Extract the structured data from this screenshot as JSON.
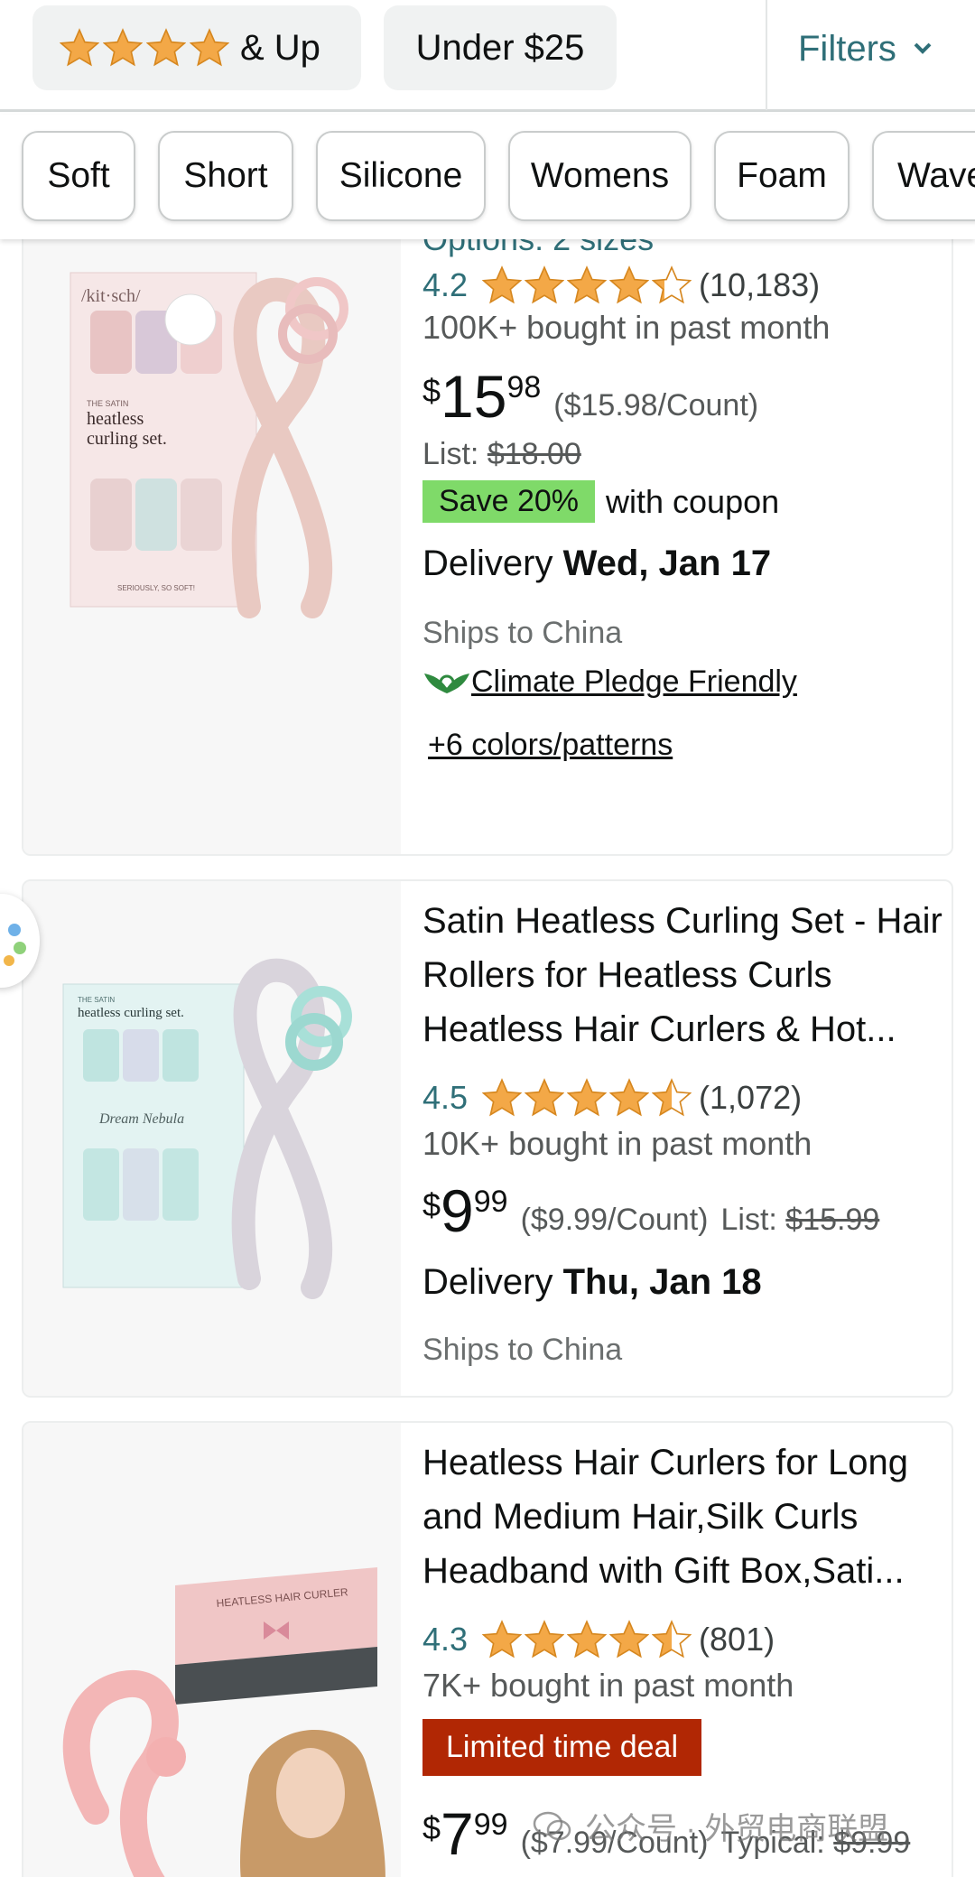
{
  "top_filters": {
    "rating_chip": "& Up",
    "price_chip": "Under $25",
    "filters_label": "Filters"
  },
  "chips": [
    "Soft",
    "Short",
    "Silicone",
    "Womens",
    "Foam",
    "Wave"
  ],
  "products": [
    {
      "options_label": "Options:",
      "options_value": "2 sizes",
      "rating": "4.2",
      "rating_count": "(10,183)",
      "bought": "100K+ bought in past month",
      "price_symbol": "$",
      "price_whole": "15",
      "price_fraction": "98",
      "unit_price": "($15.98/Count)",
      "list_label": "List:",
      "list_price": "$18.00",
      "save_badge": "Save 20%",
      "coupon_text": "with coupon",
      "delivery_label": "Delivery",
      "delivery_date": "Wed, Jan 17",
      "ships": "Ships to China",
      "climate": "Climate Pledge Friendly",
      "colors": "+6 colors/patterns",
      "image_text": {
        "brand": "/kit·sch/",
        "box_line1": "THE SATIN",
        "box_line2": "heatless",
        "box_line3": "curling set.",
        "box_tag": "SERIOUSLY, SO SOFT!"
      }
    },
    {
      "title": "Satin Heatless Curling Set - Hair Rollers for Heatless Curls Heatless Hair Curlers & Hot...",
      "rating": "4.5",
      "rating_count": "(1,072)",
      "bought": "10K+ bought in past month",
      "price_symbol": "$",
      "price_whole": "9",
      "price_fraction": "99",
      "unit_price": "($9.99/Count)",
      "list_label": "List:",
      "list_price": "$15.99",
      "delivery_label": "Delivery",
      "delivery_date": "Thu, Jan 18",
      "ships": "Ships to China",
      "image_text": {
        "box_line1": "THE SATIN",
        "box_line2": "heatless curling set.",
        "box_line3": "Dream Nebula"
      }
    },
    {
      "title": "Heatless Hair Curlers for Long and Medium Hair,Silk Curls Headband with Gift Box,Sati...",
      "rating": "4.3",
      "rating_count": "(801)",
      "bought": "7K+ bought in past month",
      "deal": "Limited time deal",
      "price_symbol": "$",
      "price_whole": "7",
      "price_fraction": "99",
      "unit_price": "($7.99/Count)",
      "typical_label": "Typical:",
      "typical_price": "$9.99",
      "image_text": {
        "box_label": "HEATLESS HAIR CURLER"
      }
    }
  ],
  "watermark": "公众号 · 外贸电商联盟",
  "colors": {
    "star": "#f3a847",
    "teal": "#2f6f78",
    "save_green": "#7fda69",
    "deal_red": "#b12704"
  }
}
